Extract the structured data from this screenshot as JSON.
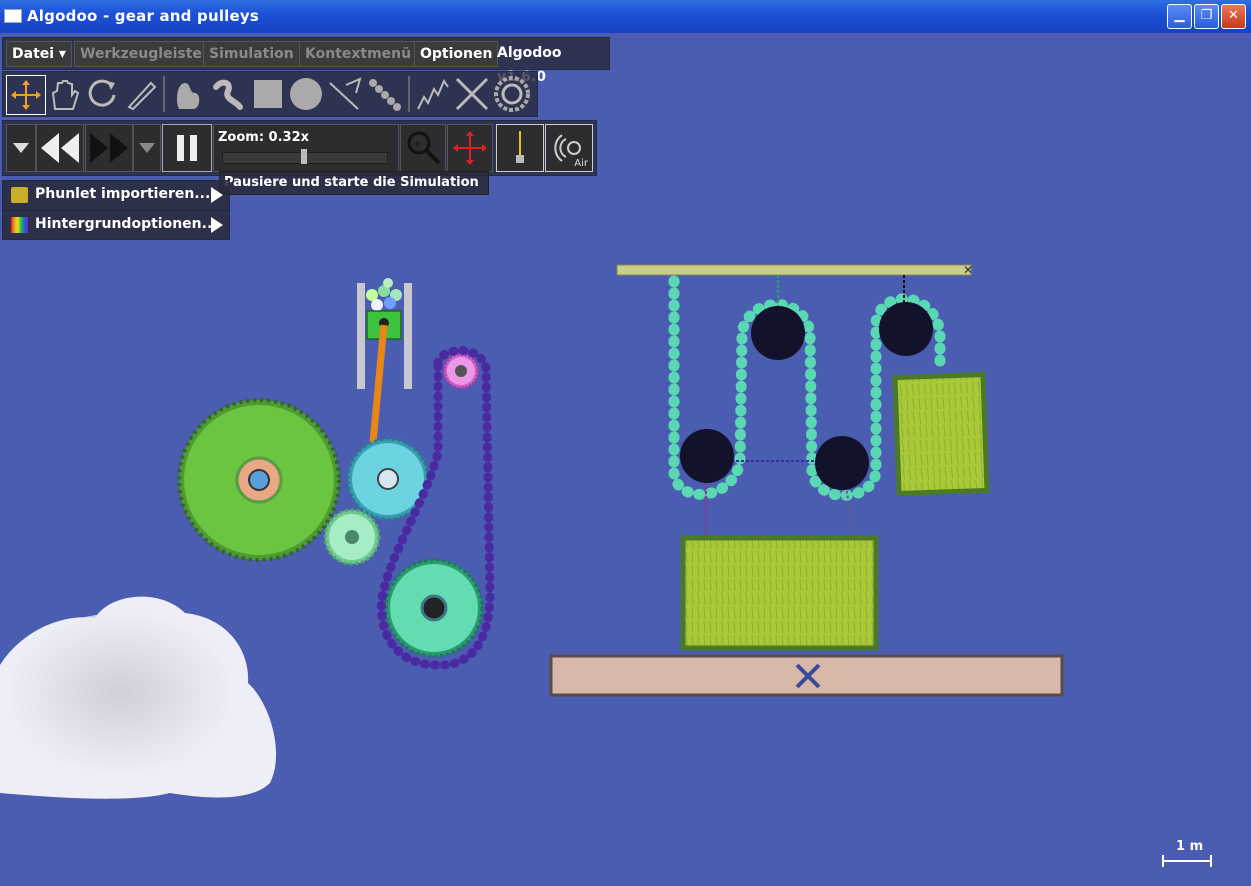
{
  "window": {
    "title": "Algodoo - gear and pulleys"
  },
  "menu": {
    "datei": "Datei",
    "werkzeugleiste": "Werkzeugleiste",
    "simulation": "Simulation",
    "kontextmenu": "Kontextmenü",
    "optionen": "Optionen",
    "version": "Algodoo v1.6.0"
  },
  "tools": [
    "move-tool",
    "drag-tool",
    "rotate-tool",
    "sketch-tool",
    "cut-tool",
    "brush-tool",
    "box-tool",
    "circle-tool",
    "plane-tool",
    "chain-tool",
    "spring-tool",
    "fixate-tool",
    "gear-tool"
  ],
  "sim": {
    "zoom_label": "Zoom: 0.32x",
    "zoom_level": 0.5,
    "tooltip": "Pausiere und starte die Simulation",
    "air_label": "Air"
  },
  "side": {
    "phunlet": "Phunlet importieren...",
    "background": "Hintergrundoptionen..."
  },
  "scale": {
    "label": "1 m"
  },
  "colors": {
    "background": "#4a5db1",
    "titlebar": "#1d52d6"
  }
}
